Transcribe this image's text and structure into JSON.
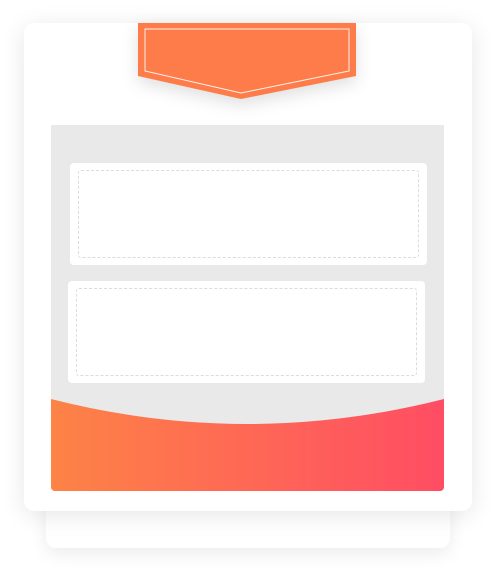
{
  "colors": {
    "ribbon": "#fd7c4a",
    "ribbon_outline": "#ffffff",
    "panel_background": "#e9e9e9",
    "gradient_start": "#fd8346",
    "gradient_end": "#ff4d64"
  },
  "slots": [
    {
      "name": "upper-empty-slot"
    },
    {
      "name": "lower-empty-slot"
    }
  ]
}
